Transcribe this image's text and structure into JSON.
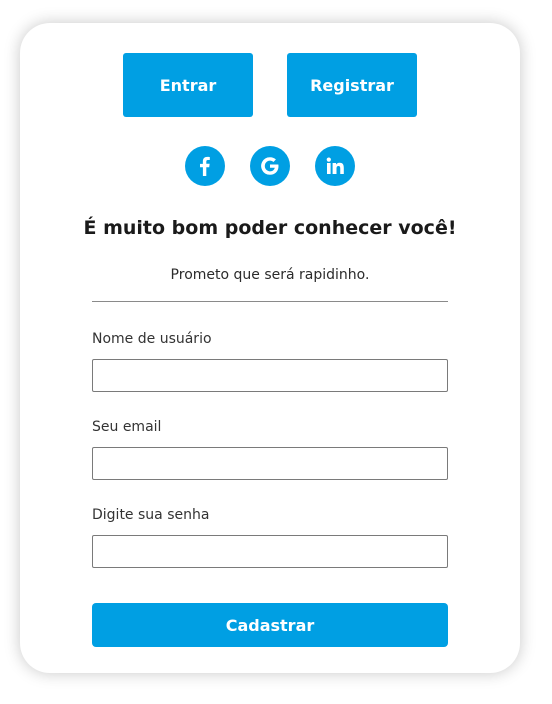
{
  "tabs": {
    "login_label": "Entrar",
    "register_label": "Registrar"
  },
  "social": [
    {
      "name": "facebook-icon"
    },
    {
      "name": "google-icon"
    },
    {
      "name": "linkedin-icon"
    }
  ],
  "form": {
    "title": "É muito bom poder conhecer você!",
    "subtitle": "Prometo que será rapidinho.",
    "username_label": "Nome de usuário",
    "username_value": "",
    "email_label": "Seu email",
    "email_value": "",
    "password_label": "Digite sua senha",
    "password_value": "",
    "submit_label": "Cadastrar"
  },
  "colors": {
    "accent": "#009fe3",
    "text": "#1a1a1a",
    "background": "#ffffff"
  }
}
